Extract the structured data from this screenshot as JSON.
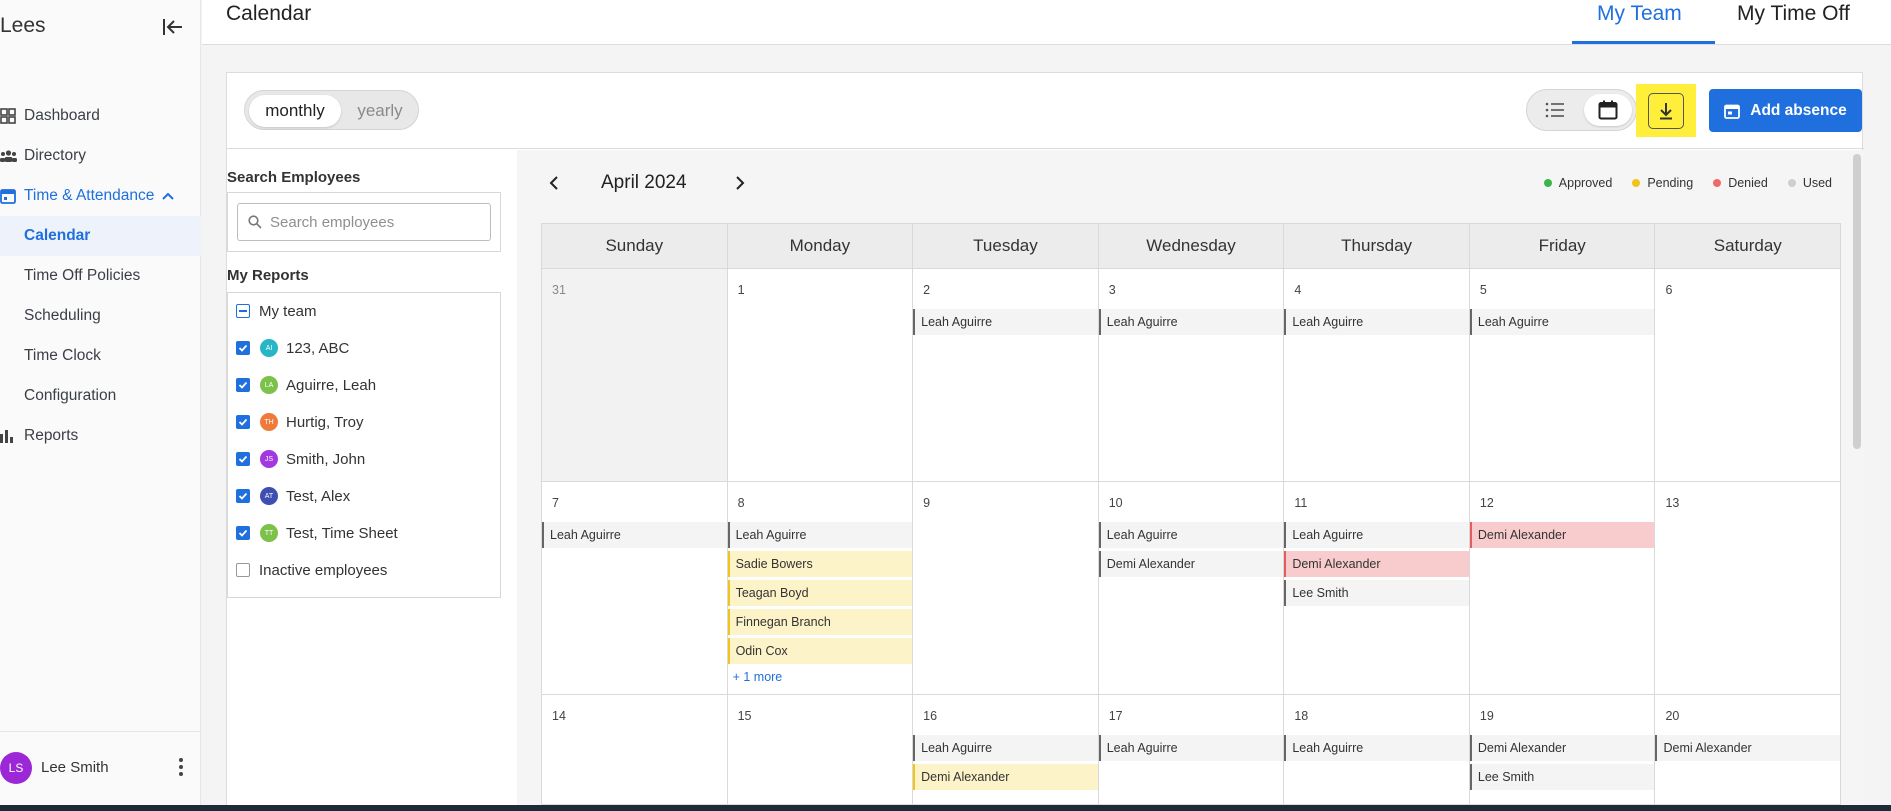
{
  "sidebar": {
    "brand": "Lees",
    "items": [
      {
        "label": "Dashboard"
      },
      {
        "label": "Directory"
      },
      {
        "label": "Time & Attendance"
      },
      {
        "label": "Calendar"
      },
      {
        "label": "Time Off Policies"
      },
      {
        "label": "Scheduling"
      },
      {
        "label": "Time Clock"
      },
      {
        "label": "Configuration"
      },
      {
        "label": "Reports"
      }
    ],
    "user": {
      "initials": "LS",
      "name": "Lee Smith"
    }
  },
  "header": {
    "title": "Calendar",
    "tabs": [
      {
        "label": "My Team"
      },
      {
        "label": "My Time Off"
      }
    ]
  },
  "toolbar": {
    "period_options": [
      "monthly",
      "yearly"
    ],
    "add_absence_label": "Add absence"
  },
  "filters": {
    "search_heading": "Search Employees",
    "search_placeholder": "Search employees",
    "reports_heading": "My Reports",
    "team_label": "My team",
    "employees": [
      {
        "initials": "AI",
        "name": "123, ABC",
        "color": "#26b6c7"
      },
      {
        "initials": "LA",
        "name": "Aguirre, Leah",
        "color": "#7cc24a"
      },
      {
        "initials": "TH",
        "name": "Hurtig, Troy",
        "color": "#f07a3a"
      },
      {
        "initials": "JS",
        "name": "Smith, John",
        "color": "#a238e0"
      },
      {
        "initials": "AT",
        "name": "Test, Alex",
        "color": "#3d4fb0"
      },
      {
        "initials": "TT",
        "name": "Test, Time Sheet",
        "color": "#7cc24a"
      }
    ],
    "inactive_label": "Inactive employees"
  },
  "calendar": {
    "month_label": "April 2024",
    "legend": [
      {
        "label": "Approved",
        "color": "#3bb54a"
      },
      {
        "label": "Pending",
        "color": "#f2c318"
      },
      {
        "label": "Denied",
        "color": "#ee6a6a"
      },
      {
        "label": "Used",
        "color": "#cfcfcf"
      }
    ],
    "weekdays": [
      "Sunday",
      "Monday",
      "Tuesday",
      "Wednesday",
      "Thursday",
      "Friday",
      "Saturday"
    ],
    "more_label": "+ 1 more",
    "weeks": [
      [
        {
          "day": "31",
          "other": true,
          "events": []
        },
        {
          "day": "1",
          "events": []
        },
        {
          "day": "2",
          "events": [
            {
              "name": "Leah Aguirre",
              "status": "approved"
            }
          ]
        },
        {
          "day": "3",
          "events": [
            {
              "name": "Leah Aguirre",
              "status": "approved"
            }
          ]
        },
        {
          "day": "4",
          "events": [
            {
              "name": "Leah Aguirre",
              "status": "approved"
            }
          ]
        },
        {
          "day": "5",
          "events": [
            {
              "name": "Leah Aguirre",
              "status": "approved"
            }
          ]
        },
        {
          "day": "6",
          "events": []
        }
      ],
      [
        {
          "day": "7",
          "events": [
            {
              "name": "Leah Aguirre",
              "status": "approved"
            }
          ]
        },
        {
          "day": "8",
          "events": [
            {
              "name": "Leah Aguirre",
              "status": "approved"
            },
            {
              "name": "Sadie Bowers",
              "status": "pending"
            },
            {
              "name": "Teagan Boyd",
              "status": "pending"
            },
            {
              "name": "Finnegan Branch",
              "status": "pending"
            },
            {
              "name": "Odin Cox",
              "status": "pending"
            }
          ],
          "more": true
        },
        {
          "day": "9",
          "events": []
        },
        {
          "day": "10",
          "events": [
            {
              "name": "Leah Aguirre",
              "status": "approved"
            },
            {
              "name": "Demi Alexander",
              "status": "approved"
            }
          ]
        },
        {
          "day": "11",
          "events": [
            {
              "name": "Leah Aguirre",
              "status": "approved"
            },
            {
              "name": "Demi Alexander",
              "status": "denied"
            },
            {
              "name": "Lee Smith",
              "status": "approved"
            }
          ]
        },
        {
          "day": "12",
          "events": [
            {
              "name": "Demi Alexander",
              "status": "denied"
            }
          ]
        },
        {
          "day": "13",
          "events": []
        }
      ],
      [
        {
          "day": "14",
          "events": []
        },
        {
          "day": "15",
          "events": []
        },
        {
          "day": "16",
          "events": [
            {
              "name": "Leah Aguirre",
              "status": "approved"
            },
            {
              "name": "Demi Alexander",
              "status": "pending"
            }
          ]
        },
        {
          "day": "17",
          "events": [
            {
              "name": "Leah Aguirre",
              "status": "approved"
            }
          ]
        },
        {
          "day": "18",
          "events": [
            {
              "name": "Leah Aguirre",
              "status": "approved"
            }
          ]
        },
        {
          "day": "19",
          "events": [
            {
              "name": "Demi Alexander",
              "status": "approved"
            },
            {
              "name": "Lee Smith",
              "status": "approved"
            }
          ]
        },
        {
          "day": "20",
          "events": [
            {
              "name": "Demi Alexander",
              "status": "approved"
            }
          ]
        }
      ]
    ]
  }
}
